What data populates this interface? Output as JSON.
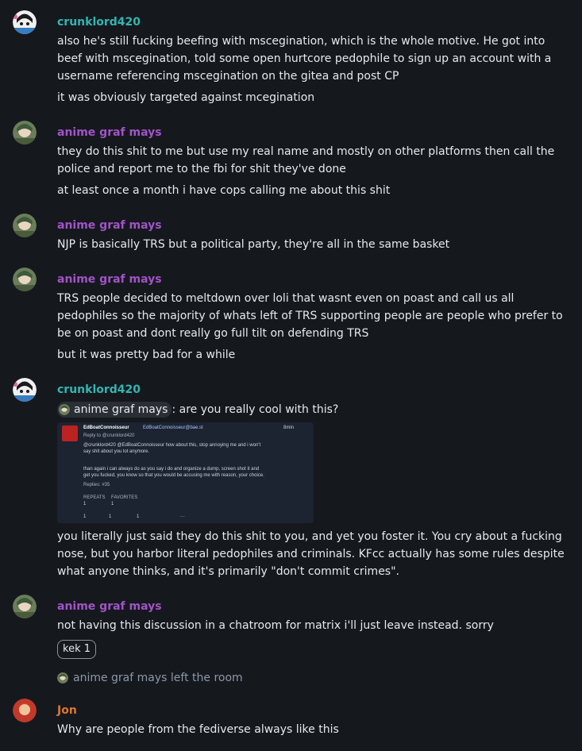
{
  "messages": [
    {
      "sender": "crunklord420",
      "lines": [
        "also he's still fucking beefing with mscegination, which is the whole motive. He got into beef with mscegination, told some open hurtcore pedophile to sign up an account with a username referencing mscegination on the gitea and post CP",
        "it was obviously targeted against mcegination"
      ]
    },
    {
      "sender": "anime graf mays",
      "lines": [
        "they do this shit to me but use my real name and mostly on other platforms then call the police and report me to the fbi for shit they've done",
        "at least once a month i have cops calling me about this shit"
      ]
    },
    {
      "sender": "anime graf mays",
      "lines": [
        "NJP is basically TRS but a political party, they're all in the same basket"
      ]
    },
    {
      "sender": "anime graf mays",
      "lines": [
        "TRS people decided to meltdown over loli that wasnt even on poast and call us all pedophiles so the majority of whats left of TRS supporting people are people who prefer to be on poast and dont really go full tilt on defending TRS",
        "but it was pretty bad for a while"
      ]
    },
    {
      "sender": "crunklord420",
      "mention": "anime graf mays",
      "mention_suffix": ": are you really cool with this?",
      "screenshot": {
        "name": "EdBoatConnoisseur",
        "handle": "EdBoatConnoisseur@bae.st",
        "time": "8min",
        "reply_to": "Reply to @crunklord420",
        "line1": "@crunklord420 @EdBoatConnoisseur how about this, stop annoying me and i won't",
        "line2": "say shit about you lot anymore.",
        "line3": "than again i can always do as you say i do and organize a dump, screen shot it and",
        "line4": "get you fucked, you know so that you would be accusing me with reason, your choice.",
        "replies": "Replies: #35",
        "repeats_label": "REPEATS",
        "favorites_label": "FAVORITES",
        "repeats": "1",
        "favorites": "1",
        "action_reply": "1",
        "action_repeat": "1",
        "action_fav": "1",
        "action_more": "···"
      },
      "lines": [
        "you literally just said they do this shit to you, and yet you foster it. You cry about a fucking nose, but you harbor literal pedophiles and criminals. KFcc actually has some rules despite what anyone thinks, and it's primarily \"don't commit crimes\"."
      ]
    },
    {
      "sender": "anime graf mays",
      "lines": [
        "not having this discussion in a chatroom for matrix i'll just leave instead. sorry"
      ],
      "reaction": "kek 1"
    },
    {
      "event": "anime graf mays left the room"
    },
    {
      "sender": "Jon",
      "lines": [
        "Why are people from the fediverse always like this"
      ]
    }
  ],
  "colors": {
    "crunklord420": "#31b6b1",
    "anime_graf_mays": "#a352c8",
    "jon": "#e07530",
    "background": "#15191e"
  }
}
